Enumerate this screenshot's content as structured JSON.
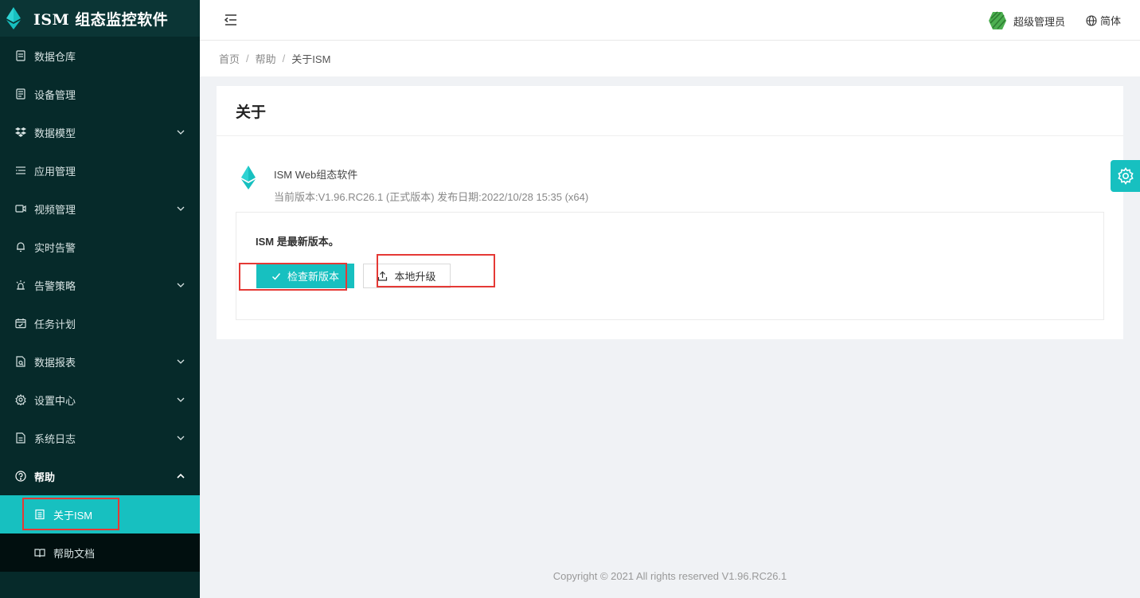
{
  "app": {
    "title": "ISM 组态监控软件"
  },
  "colors": {
    "accent": "#17c0c0",
    "sidebar_bg": "#062a2a",
    "highlight": "#e53935"
  },
  "sidebar": {
    "items": [
      {
        "label": "数据仓库",
        "icon": "database-icon",
        "has_arrow": false
      },
      {
        "label": "设备管理",
        "icon": "device-icon",
        "has_arrow": false
      },
      {
        "label": "数据模型",
        "icon": "model-icon",
        "has_arrow": true
      },
      {
        "label": "应用管理",
        "icon": "app-list-icon",
        "has_arrow": false
      },
      {
        "label": "视频管理",
        "icon": "video-icon",
        "has_arrow": true
      },
      {
        "label": "实时告警",
        "icon": "bell-icon",
        "has_arrow": false
      },
      {
        "label": "告警策略",
        "icon": "alarm-light-icon",
        "has_arrow": true
      },
      {
        "label": "任务计划",
        "icon": "calendar-icon",
        "has_arrow": false
      },
      {
        "label": "数据报表",
        "icon": "report-icon",
        "has_arrow": true
      },
      {
        "label": "设置中心",
        "icon": "gear-icon",
        "has_arrow": true
      },
      {
        "label": "系统日志",
        "icon": "log-icon",
        "has_arrow": true
      },
      {
        "label": "帮助",
        "icon": "help-icon",
        "has_arrow": true
      }
    ],
    "help_submenu": [
      {
        "label": "关于ISM",
        "icon": "document-icon",
        "active": true
      },
      {
        "label": "帮助文档",
        "icon": "book-icon",
        "active": false
      }
    ]
  },
  "header": {
    "user_name": "超级管理员",
    "language": "简体"
  },
  "breadcrumb": [
    "首页",
    "帮助",
    "关于ISM"
  ],
  "about": {
    "title": "关于",
    "app_name": "ISM Web组态软件",
    "version_info": "当前版本:V1.96.RC26.1 (正式版本) 发布日期:2022/10/28 15:35 (x64)",
    "status": "ISM 是最新版本。",
    "check_button": "检查新版本",
    "upgrade_button": "本地升级"
  },
  "footer": {
    "text": "Copyright © 2021 All rights reserved V1.96.RC26.1"
  }
}
